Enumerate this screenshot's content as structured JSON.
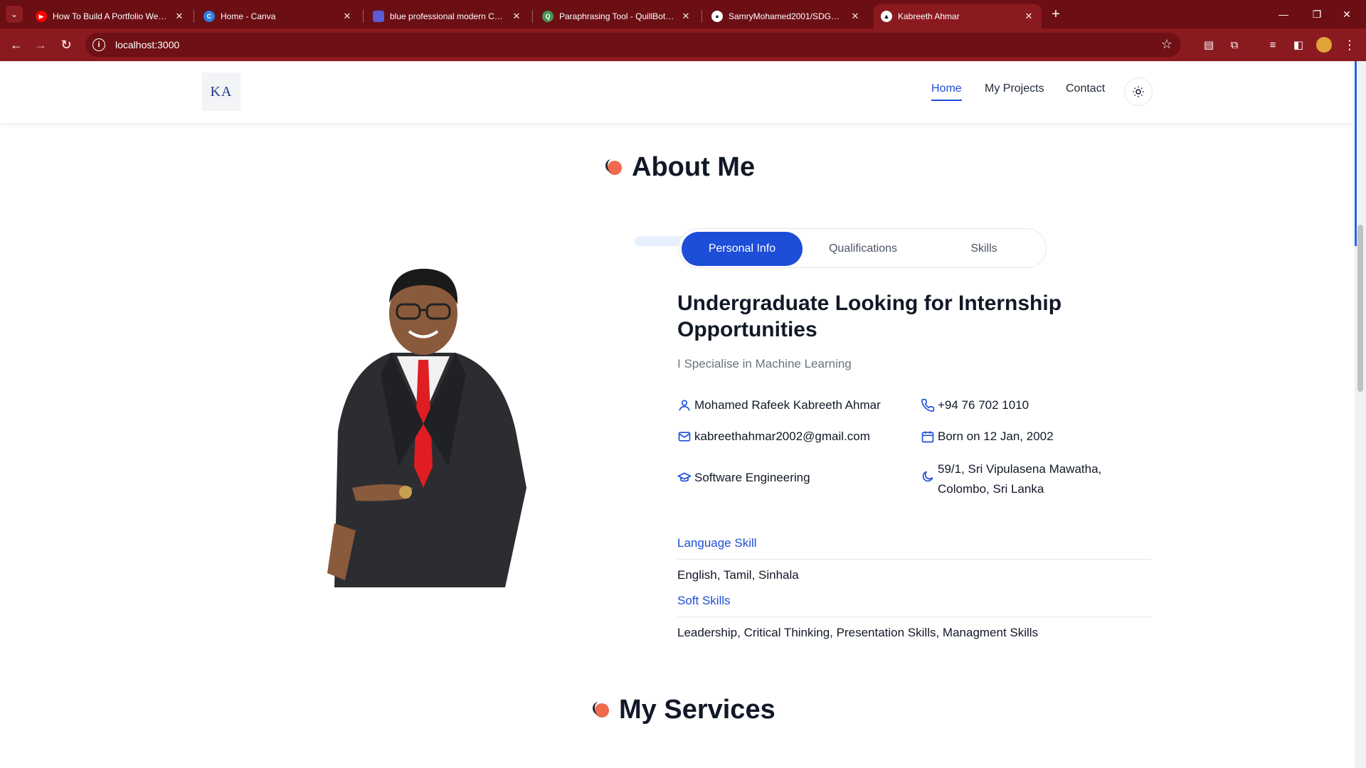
{
  "browser": {
    "tabs": [
      {
        "title": "How To Build A Portfolio Websit",
        "favicon": "youtube-icon",
        "color": "#ff0000"
      },
      {
        "title": "Home - Canva",
        "favicon": "canva-icon",
        "color": "#00c4cc"
      },
      {
        "title": "blue professional modern CV re",
        "favicon": "canva-doc-icon",
        "color": "#7d2ae8"
      },
      {
        "title": "Paraphrasing Tool - QuillBot AI",
        "favicon": "quillbot-icon",
        "color": "#499557"
      },
      {
        "title": "SamryMohamed2001/SDGP-SE",
        "favicon": "github-icon",
        "color": "#24292f"
      },
      {
        "title": "Kabreeth Ahmar",
        "favicon": "nextjs-icon",
        "color": "#000000",
        "active": true
      }
    ],
    "url": "localhost:3000"
  },
  "header": {
    "logo_text": "KA",
    "nav": [
      {
        "label": "Home",
        "active": true
      },
      {
        "label": "My Projects"
      },
      {
        "label": "Contact"
      }
    ]
  },
  "about": {
    "section_title": "About Me",
    "tabs": [
      "Personal Info",
      "Qualifications",
      "Skills"
    ],
    "active_tab": "Personal Info",
    "headline": "Undergraduate Looking for Internship Opportunities",
    "subtitle": "I Specialise in Machine Learning",
    "info": {
      "name": "Mohamed Rafeek Kabreeth Ahmar",
      "phone": "+94 76 702 1010",
      "email": "kabreethahmar2002@gmail.com",
      "born": "Born on 12 Jan, 2002",
      "field": "Software Engineering",
      "address_line1": "59/1, Sri Vipulasena Mawatha,",
      "address_line2": "Colombo, Sri Lanka"
    },
    "language_title": "Language Skill",
    "languages": "English, Tamil, Sinhala",
    "soft_title": "Soft Skills",
    "soft_skills": "Leadership, Critical Thinking, Presentation Skills, Managment Skills"
  },
  "services": {
    "section_title": "My Services"
  },
  "colors": {
    "accent": "#1d4ed8",
    "browser_frame": "#8b1a20",
    "dot": "#ef6a4f"
  }
}
